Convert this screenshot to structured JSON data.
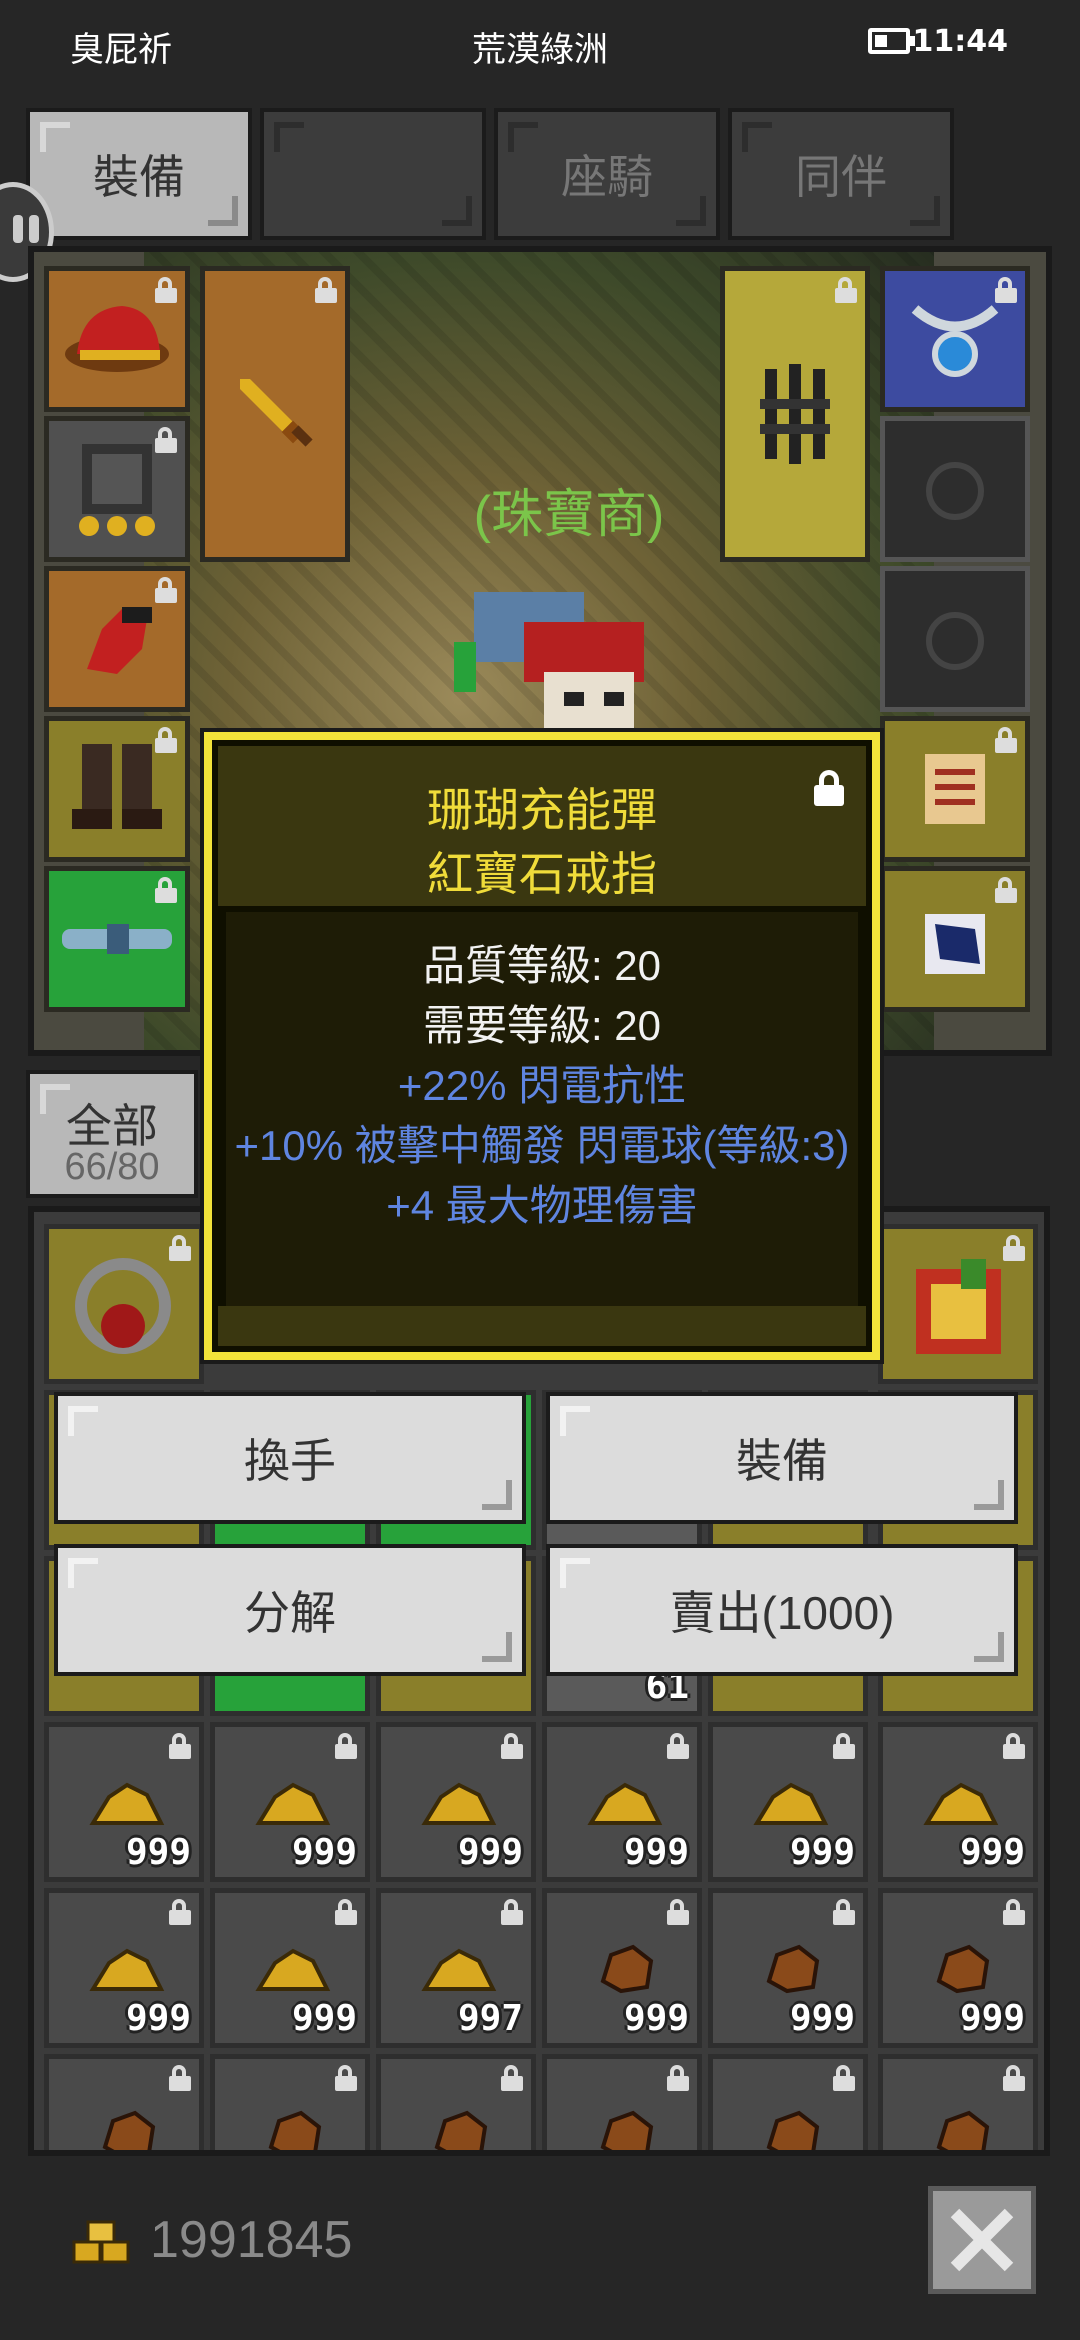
{
  "status_bar": {
    "left_text": "臭屁祈",
    "center_text": "荒漠綠洲",
    "time": "11:44"
  },
  "tabs": [
    {
      "label": "裝備",
      "active": true
    },
    {
      "label": "",
      "active": false
    },
    {
      "label": "座騎",
      "active": false
    },
    {
      "label": "同伴",
      "active": false
    }
  ],
  "character": {
    "name": "(珠寶商)"
  },
  "filter": {
    "label": "全部",
    "count": "66/80"
  },
  "tooltip": {
    "title_line1": "珊瑚充能彈",
    "title_line2": "紅寶石戒指",
    "stats": [
      {
        "text": "品質等級: 20",
        "color": "white"
      },
      {
        "text": "需要等級: 20",
        "color": "white"
      },
      {
        "text": "+22% 閃電抗性",
        "color": "blue"
      },
      {
        "text": "+10% 被擊中觸發 閃電球(等級:3)",
        "color": "blue"
      },
      {
        "text": "+4 最大物理傷害",
        "color": "blue"
      }
    ]
  },
  "actions": {
    "swap_hand": "換手",
    "equip": "裝備",
    "disassemble": "分解",
    "sell": "賣出(1000)"
  },
  "inventory": {
    "partial_count": "61",
    "rows": [
      [
        "999",
        "999",
        "999",
        "999",
        "999",
        "999"
      ],
      [
        "999",
        "999",
        "997",
        "999",
        "999",
        "999"
      ]
    ]
  },
  "gold": {
    "amount": "1991845"
  },
  "colors": {
    "tooltip_border": "#f3e33a",
    "tooltip_title": "#f0dc3a",
    "stat_blue": "#5f85e0",
    "character_name": "#7bc54a"
  }
}
